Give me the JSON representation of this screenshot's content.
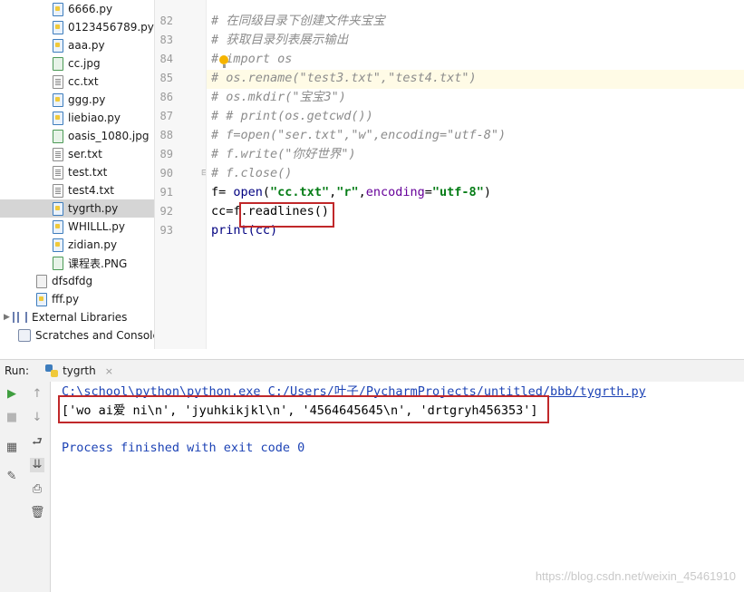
{
  "project_tree": {
    "items": [
      {
        "label": "6666.py",
        "icon": "python-file-icon",
        "type": "py"
      },
      {
        "label": "0123456789.py",
        "icon": "python-file-icon",
        "type": "py"
      },
      {
        "label": "aaa.py",
        "icon": "python-file-icon",
        "type": "py"
      },
      {
        "label": "cc.jpg",
        "icon": "image-file-icon",
        "type": "img"
      },
      {
        "label": "cc.txt",
        "icon": "text-file-icon",
        "type": "txt"
      },
      {
        "label": "ggg.py",
        "icon": "python-file-icon",
        "type": "py"
      },
      {
        "label": "liebiao.py",
        "icon": "python-file-icon",
        "type": "py"
      },
      {
        "label": "oasis_1080.jpg",
        "icon": "image-file-icon",
        "type": "img"
      },
      {
        "label": "ser.txt",
        "icon": "text-file-icon",
        "type": "txt"
      },
      {
        "label": "test.txt",
        "icon": "text-file-icon",
        "type": "txt"
      },
      {
        "label": "test4.txt",
        "icon": "text-file-icon",
        "type": "txt"
      },
      {
        "label": "tygrth.py",
        "icon": "python-file-icon",
        "type": "py",
        "selected": true
      },
      {
        "label": "WHILLL.py",
        "icon": "python-file-icon",
        "type": "py"
      },
      {
        "label": "zidian.py",
        "icon": "python-file-icon",
        "type": "py"
      },
      {
        "label": "课程表.PNG",
        "icon": "image-file-icon",
        "type": "img"
      },
      {
        "label": "dfsdfdg",
        "icon": "plain-file-icon",
        "type": "plain",
        "indent": "outer"
      },
      {
        "label": "fff.py",
        "icon": "python-file-icon",
        "type": "py",
        "indent": "outer"
      }
    ],
    "external_libraries": "External Libraries",
    "scratches": "Scratches and Console"
  },
  "editor": {
    "line_numbers": [
      "82",
      "83",
      "84",
      "85",
      "86",
      "87",
      "88",
      "89",
      "90",
      "91",
      "92",
      "93"
    ],
    "lines": [
      {
        "kind": "comment",
        "text": "# 在同级目录下创建文件夹宝宝"
      },
      {
        "kind": "comment",
        "text": "# 获取目录列表展示输出"
      },
      {
        "kind": "comment",
        "text": "# import os"
      },
      {
        "kind": "comment",
        "text": "# os.rename(\"test3.txt\",\"test4.txt\")"
      },
      {
        "kind": "comment",
        "text": "# os.mkdir(\"宝宝3\")"
      },
      {
        "kind": "comment",
        "text": "# # print(os.getcwd())"
      },
      {
        "kind": "comment",
        "text": "# f=open(\"ser.txt\",\"w\",encoding=\"utf-8\")"
      },
      {
        "kind": "comment",
        "text": "# f.write(\"你好世界\")"
      },
      {
        "kind": "comment",
        "text": "# f.close()"
      },
      {
        "kind": "code",
        "parts": {
          "a": "f= ",
          "b": "open",
          "c": "(",
          "d": "\"cc.txt\"",
          "e": ",",
          "f": "\"r\"",
          "g": ",",
          "h": "encoding",
          "i": "=",
          "j": "\"utf-8\"",
          "k": ")"
        }
      },
      {
        "kind": "code2",
        "text": "cc=f.readlines()"
      },
      {
        "kind": "code2",
        "text": "print(cc)"
      }
    ]
  },
  "run_panel": {
    "label": "Run:",
    "tab_title": "tygrth",
    "tab_close": "×",
    "command": "C:\\school\\python\\python.exe C:/Users/叶子/PycharmProjects/untitled/bbb/tygrth.py",
    "output": "['wo ai爱 ni\\n', 'jyuhkikjkl\\n', '4564645645\\n', 'drtgryh456353']",
    "exit_message": "Process finished with exit code 0",
    "toolbar_icons": [
      "run-icon",
      "up-icon",
      "stop-icon",
      "down-icon",
      "soft-wrap-icon",
      "layout-icon",
      "scroll-to-end-icon",
      "pin-icon",
      "print-icon",
      "trash-icon"
    ]
  },
  "watermark": "https://blog.csdn.net/weixin_45461910",
  "colors": {
    "string_green": "#067d17",
    "comment_gray": "#8c8c8c",
    "console_blue": "#1d43b5",
    "annotation_red": "#c0282a",
    "selection_gray": "#d5d5d5"
  }
}
